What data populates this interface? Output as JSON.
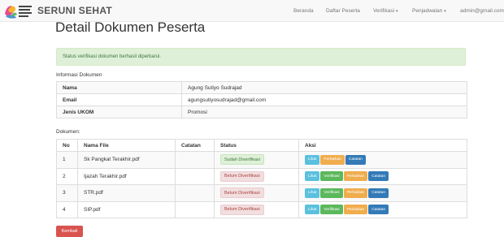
{
  "navbar": {
    "brand": "SERUNI SEHAT",
    "items": [
      {
        "label": "Beranda"
      },
      {
        "label": "Daftar Peserta"
      },
      {
        "label": "Verifikasi",
        "dropdown": true
      },
      {
        "label": "Penjadwalan",
        "dropdown": true
      },
      {
        "label": "admin@gmail.com"
      }
    ]
  },
  "page_title": "Detail Dokumen Peserta",
  "alert": "Status verifikasi dokumen berhasil diperbarui.",
  "info": {
    "section_label": "Informasi Dokumen",
    "rows": [
      {
        "key": "Nama",
        "value": "Agung Sutiyo Sudrajad"
      },
      {
        "key": "Email",
        "value": "agungsutiyosudrajad@gmail.com"
      },
      {
        "key": "Jenis UKOM",
        "value": "Promosi"
      }
    ]
  },
  "documents": {
    "section_label": "Dokumen:",
    "headers": [
      "No",
      "Nama File",
      "Catatan",
      "Status",
      "Aksi"
    ],
    "rows": [
      {
        "no": "1",
        "file": "Sk Pangkat Terakhir.pdf",
        "note": "",
        "status": "Sudah Diverifikasi",
        "verified": true
      },
      {
        "no": "2",
        "file": "Ijazah Terakhir.pdf",
        "note": "",
        "status": "Belum Diverifikasi",
        "verified": false
      },
      {
        "no": "3",
        "file": "STR.pdf",
        "note": "",
        "status": "Belum Diverifikasi",
        "verified": false
      },
      {
        "no": "4",
        "file": "SIP.pdf",
        "note": "",
        "status": "Belum Diverifikasi",
        "verified": false
      }
    ],
    "actions": {
      "view": "Lihat",
      "verify": "Verifikasi",
      "revise": "Perbaikan",
      "note": "Catatan"
    }
  },
  "back_button": "Kembali",
  "colors": {
    "success": "#5cb85c",
    "info": "#5bc0de",
    "warning": "#f0ad4e",
    "primary": "#337ab7",
    "danger": "#d9534f"
  }
}
